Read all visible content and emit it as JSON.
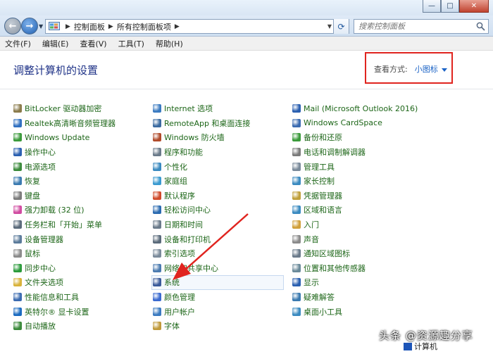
{
  "window": {
    "minimize_glyph": "—",
    "maximize_glyph": "□",
    "close_glyph": "✕"
  },
  "nav": {
    "back_glyph": "←",
    "forward_glyph": "→"
  },
  "address": {
    "crumbs": [
      "控制面板",
      "所有控制面板项"
    ]
  },
  "search": {
    "placeholder": "搜索控制面板"
  },
  "menu": [
    "文件(F)",
    "编辑(E)",
    "查看(V)",
    "工具(T)",
    "帮助(H)"
  ],
  "page": {
    "heading": "调整计算机的设置",
    "view_by_label": "查看方式:",
    "view_by_value": "小图标"
  },
  "columns": [
    [
      {
        "label": "BitLocker 驱动器加密",
        "icon": "bitlocker-icon",
        "color": "#8a7a4a"
      },
      {
        "label": "Realtek高清晰音频管理器",
        "icon": "realtek-audio-icon",
        "color": "#2f6fc0"
      },
      {
        "label": "Windows Update",
        "icon": "windows-update-icon",
        "color": "#3a9a3a"
      },
      {
        "label": "操作中心",
        "icon": "action-center-icon",
        "color": "#2a5fb0"
      },
      {
        "label": "电源选项",
        "icon": "power-options-icon",
        "color": "#3a8a3a"
      },
      {
        "label": "恢复",
        "icon": "recovery-icon",
        "color": "#3a7ab0"
      },
      {
        "label": "键盘",
        "icon": "keyboard-icon",
        "color": "#7a7a7a"
      },
      {
        "label": "强力卸载 (32 位)",
        "icon": "uninstall-icon",
        "color": "#d04aa0"
      },
      {
        "label": "任务栏和「开始」菜单",
        "icon": "taskbar-icon",
        "color": "#5a6a7a"
      },
      {
        "label": "设备管理器",
        "icon": "device-manager-icon",
        "color": "#5a7a9a"
      },
      {
        "label": "鼠标",
        "icon": "mouse-icon",
        "color": "#8a8a8a"
      },
      {
        "label": "同步中心",
        "icon": "sync-center-icon",
        "color": "#2a9a3a"
      },
      {
        "label": "文件夹选项",
        "icon": "folder-options-icon",
        "color": "#d8b23a"
      },
      {
        "label": "性能信息和工具",
        "icon": "performance-icon",
        "color": "#3a6ab0"
      },
      {
        "label": "英特尔® 显卡设置",
        "icon": "intel-graphics-icon",
        "color": "#1a6ac0"
      },
      {
        "label": "自动播放",
        "icon": "autoplay-icon",
        "color": "#3a8a3a"
      }
    ],
    [
      {
        "label": "Internet 选项",
        "icon": "internet-options-icon",
        "color": "#3a7ac0"
      },
      {
        "label": "RemoteApp 和桌面连接",
        "icon": "remoteapp-icon",
        "color": "#3a6aa0"
      },
      {
        "label": "Windows 防火墙",
        "icon": "firewall-icon",
        "color": "#b04a2a"
      },
      {
        "label": "程序和功能",
        "icon": "programs-icon",
        "color": "#6a7a8a"
      },
      {
        "label": "个性化",
        "icon": "personalization-icon",
        "color": "#3a8ac0"
      },
      {
        "label": "家庭组",
        "icon": "homegroup-icon",
        "color": "#3a9ad0"
      },
      {
        "label": "默认程序",
        "icon": "default-programs-icon",
        "color": "#d04a2a"
      },
      {
        "label": "轻松访问中心",
        "icon": "ease-of-access-icon",
        "color": "#2a6ab0"
      },
      {
        "label": "日期和时间",
        "icon": "date-time-icon",
        "color": "#6a7a8a"
      },
      {
        "label": "设备和打印机",
        "icon": "devices-printers-icon",
        "color": "#5a6a7a"
      },
      {
        "label": "索引选项",
        "icon": "indexing-icon",
        "color": "#7a8a9a"
      },
      {
        "label": "网络和共享中心",
        "icon": "network-icon",
        "color": "#4a7ab0"
      },
      {
        "label": "系统",
        "icon": "system-icon",
        "color": "#3a5a9a"
      },
      {
        "label": "颜色管理",
        "icon": "color-management-icon",
        "color": "#3a6ad0"
      },
      {
        "label": "用户帐户",
        "icon": "user-accounts-icon",
        "color": "#3a7ac0"
      },
      {
        "label": "字体",
        "icon": "fonts-icon",
        "color": "#c09a3a"
      }
    ],
    [
      {
        "label": "Mail (Microsoft Outlook 2016)",
        "icon": "mail-icon",
        "color": "#2a5fb0"
      },
      {
        "label": "Windows CardSpace",
        "icon": "cardspace-icon",
        "color": "#3a6ab0"
      },
      {
        "label": "备份和还原",
        "icon": "backup-icon",
        "color": "#3a9a3a"
      },
      {
        "label": "电话和调制解调器",
        "icon": "phone-modem-icon",
        "color": "#7a7a7a"
      },
      {
        "label": "管理工具",
        "icon": "admin-tools-icon",
        "color": "#7a8a9a"
      },
      {
        "label": "家长控制",
        "icon": "parental-controls-icon",
        "color": "#3a8ac0"
      },
      {
        "label": "凭据管理器",
        "icon": "credential-manager-icon",
        "color": "#c0a03a"
      },
      {
        "label": "区域和语言",
        "icon": "region-language-icon",
        "color": "#3a8ac0"
      },
      {
        "label": "入门",
        "icon": "getting-started-icon",
        "color": "#d0a03a"
      },
      {
        "label": "声音",
        "icon": "sound-icon",
        "color": "#8a8a8a"
      },
      {
        "label": "通知区域图标",
        "icon": "notification-area-icon",
        "color": "#6a7a8a"
      },
      {
        "label": "位置和其他传感器",
        "icon": "location-sensors-icon",
        "color": "#6a8a9a"
      },
      {
        "label": "显示",
        "icon": "display-icon",
        "color": "#2a5fb0"
      },
      {
        "label": "疑难解答",
        "icon": "troubleshooting-icon",
        "color": "#3a7ab0"
      },
      {
        "label": "桌面小工具",
        "icon": "gadgets-icon",
        "color": "#3a8ac0"
      }
    ]
  ],
  "overlay": {
    "watermark": "头条 @资源趣分享",
    "taskbar_label": "计算机"
  }
}
